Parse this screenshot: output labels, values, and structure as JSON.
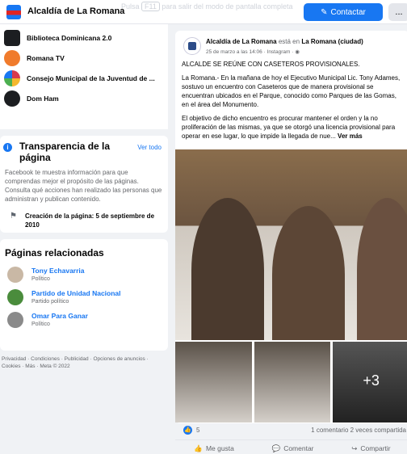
{
  "topbar": {
    "title": "Alcaldía de La Romana",
    "fullscreen_hint_pre": "Pulsa",
    "fullscreen_key": "F11",
    "fullscreen_hint_post": "para salir del modo de pantalla completa",
    "contact_label": "Contactar",
    "more_label": "..."
  },
  "liked_pages": [
    {
      "name": "Biblioteca Dominicana 2.0",
      "color": "#1c1e21"
    },
    {
      "name": "Romana TV",
      "color": "#f07b2c"
    },
    {
      "name": "Consejo Municipal de la Juventud de ...",
      "color": "#d83a4d"
    },
    {
      "name": "Dom Ham",
      "color": "#1c1e21"
    }
  ],
  "transparency": {
    "title": "Transparencia de la página",
    "see_all": "Ver todo",
    "description": "Facebook te muestra información para que comprendas mejor el propósito de las páginas. Consulta qué acciones han realizado las personas que administran y publican contenido.",
    "creation": "Creación de la página: 5 de septiembre de 2010"
  },
  "related": {
    "title": "Páginas relacionadas",
    "items": [
      {
        "name": "Tony Echavarria",
        "category": "Político"
      },
      {
        "name": "Partido de Unidad Nacional",
        "category": "Partido político"
      },
      {
        "name": "Omar Para Ganar",
        "category": "Político"
      }
    ]
  },
  "footer": "Privacidad · Condiciones · Publicidad · Opciones de anuncios · Cookies · Más · Meta © 2022",
  "post": {
    "author": "Alcaldía de La Romana",
    "in_text": "está en",
    "location": "La Romana (ciudad)",
    "date": "25 de marzo a las 14:06 · Instagram · ",
    "headline": "ALCALDE SE REÚNE CON CASETEROS PROVISIONALES.",
    "paragraph1": "La Romana.- En la mañana de hoy el Ejecutivo Municipal Lic. Tony Adames, sostuvo un encuentro con Caseteros que de manera provisional se encuentran ubicados en el Parque, conocido como Parques de las Gomas, en el área del Monumento.",
    "paragraph2": "El objetivo de dicho encuentro es procurar mantener el orden y la no proliferación de las mismas, ya que se otorgó una licencia provisional para operar en ese lugar, lo que impide la llegada de nue...",
    "see_more": "Ver más",
    "extra_photos": "+3",
    "likes": "5",
    "comments_shares": "1 comentario  2 veces compartida",
    "like_label": "Me gusta",
    "comment_label": "Comentar",
    "share_label": "Compartir"
  }
}
